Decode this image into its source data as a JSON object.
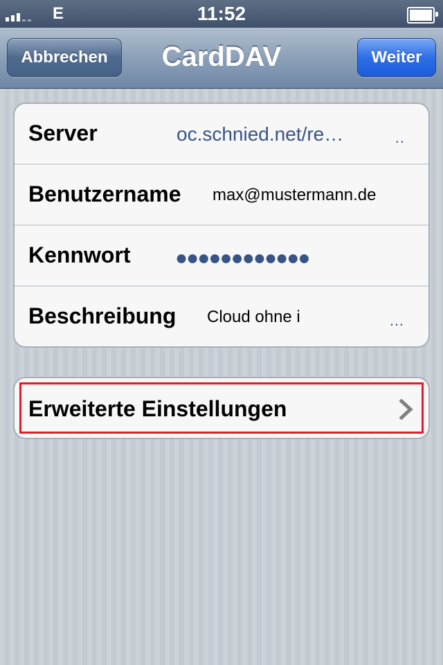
{
  "status_bar": {
    "carrier": "E",
    "time": "11:52",
    "signal_icon": "signal-bars-icon",
    "battery_icon": "battery-icon"
  },
  "nav": {
    "title": "CardDAV",
    "cancel_label": "Abbrechen",
    "next_label": "Weiter"
  },
  "form": {
    "rows": [
      {
        "label": "Server",
        "value": "oc.schnied.net/re…",
        "trailing": ".."
      },
      {
        "label": "Benutzername",
        "value": "max@mustermann.de"
      },
      {
        "label": "Kennwort",
        "value": "●●●●●●●●●●●●"
      },
      {
        "label": "Beschreibung",
        "value": "Cloud ohne i",
        "trailing": "…"
      }
    ]
  },
  "advanced": {
    "label": "Erweiterte Einstellungen",
    "icon": "chevron-right-icon"
  },
  "colors": {
    "highlight": "#e21b27",
    "value_blue": "#385487",
    "next_button": "#2e6ee6"
  }
}
